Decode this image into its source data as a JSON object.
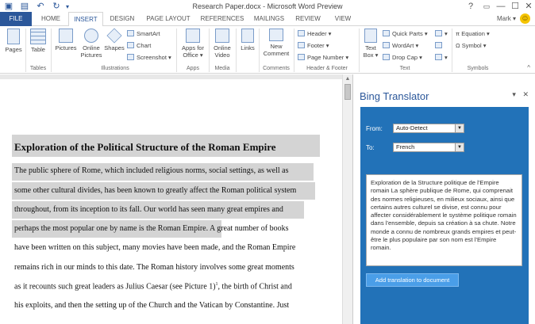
{
  "window": {
    "title": "Research Paper.docx - Microsoft Word Preview",
    "controls": {
      "help": "?",
      "restore": "▭",
      "minimize": "—",
      "maximize": "☐",
      "close": "✕"
    }
  },
  "tabs": [
    {
      "label": "FILE"
    },
    {
      "label": "HOME"
    },
    {
      "label": "INSERT"
    },
    {
      "label": "DESIGN"
    },
    {
      "label": "PAGE LAYOUT"
    },
    {
      "label": "REFERENCES"
    },
    {
      "label": "MAILINGS"
    },
    {
      "label": "REVIEW"
    },
    {
      "label": "VIEW"
    }
  ],
  "user": {
    "name": "Mark ▾"
  },
  "ribbon": {
    "pages": "Pages",
    "table": "Table",
    "pictures": "Pictures",
    "online_pictures_1": "Online",
    "online_pictures_2": "Pictures",
    "shapes": "Shapes",
    "smartart": "SmartArt",
    "chart": "Chart",
    "screenshot": "Screenshot ▾",
    "apps_for_office_1": "Apps for",
    "apps_for_office_2": "Office ▾",
    "online_video_1": "Online",
    "online_video_2": "Video",
    "links": "Links",
    "new_comment_1": "New",
    "new_comment_2": "Comment",
    "header": "Header ▾",
    "footer": "Footer ▾",
    "page_number": "Page Number ▾",
    "text_box_1": "Text",
    "text_box_2": "Box ▾",
    "quick_parts": "Quick Parts ▾",
    "wordart": "WordArt ▾",
    "drop_cap": "Drop Cap ▾",
    "equation": "π  Equation ▾",
    "symbol": "Ω  Symbol ▾",
    "groups": {
      "tables": "Tables",
      "illustrations": "Illustrations",
      "apps": "Apps",
      "media": "Media",
      "comments": "Comments",
      "header_footer": "Header & Footer",
      "text": "Text",
      "symbols": "Symbols"
    }
  },
  "document": {
    "heading": "Exploration of the Political Structure of the Roman Empire",
    "lines": [
      "The public sphere of Rome, which included religious norms, social settings, as well as",
      "some other cultural divides, has been known to greatly affect the Roman political system",
      "throughout, from its inception to its fall. Our world has seen many great empires and",
      "perhaps the most popular one by name is the Roman Empire. A great number of books",
      "have been written on this subject, many movies have been made, and the Roman Empire",
      "remains rich in our minds to this date. The Roman history involves some great moments",
      "as it recounts such great leaders as Julius Caesar (see Picture 1)",
      "his exploits, and then the setting up of the Church and the Vatican by Constantine. Just"
    ],
    "footnote_mark": "1",
    "line7_tail": ", the birth of Christ and"
  },
  "pane": {
    "title": "Bing Translator",
    "dropdown_icon": "▾",
    "close_icon": "✕",
    "from_label": "From:",
    "from_value": "Auto-Detect",
    "to_label": "To:",
    "to_value": "French",
    "result": "Exploration de la Structure politique de l'Empire romain La sphère publique de Rome, qui comprenait des normes religieuses, en milieux sociaux, ainsi que certains autres culturel se divise, est connu pour affecter considérablement le système politique romain dans l'ensemble, depuis sa création à sa chute. Notre monde a connu de nombreux grands empires et peut-être le plus populaire par son nom est l'Empire romain.",
    "add_button": "Add translation to document",
    "accent_color": "#2272b8"
  }
}
